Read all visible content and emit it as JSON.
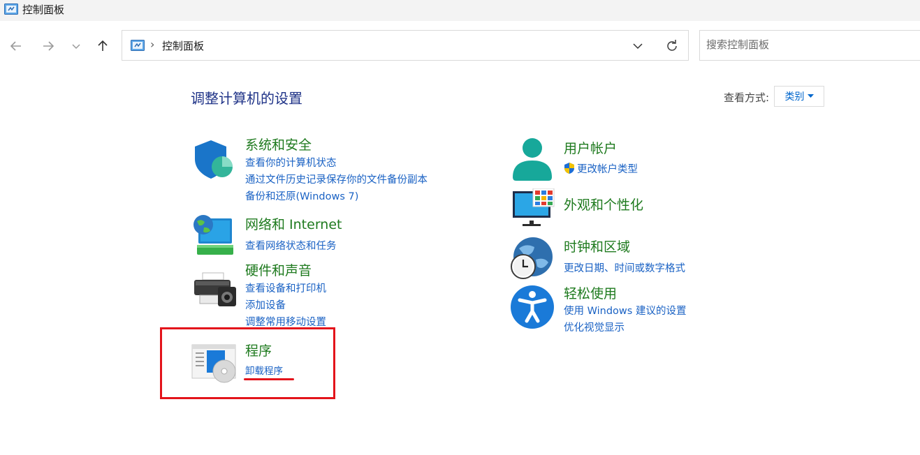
{
  "window": {
    "title": "控制面板"
  },
  "address": {
    "path_label": "控制面板",
    "separator": "›"
  },
  "search": {
    "placeholder": "搜索控制面板"
  },
  "page": {
    "heading": "调整计算机的设置",
    "view_by_label": "查看方式:",
    "view_by_value": "类别"
  },
  "categories": {
    "system_security": {
      "title": "系统和安全",
      "links": [
        "查看你的计算机状态",
        "通过文件历史记录保存你的文件备份副本",
        "备份和还原(Windows 7)"
      ]
    },
    "network": {
      "title": "网络和 Internet",
      "links": [
        "查看网络状态和任务"
      ]
    },
    "hardware": {
      "title": "硬件和声音",
      "links": [
        "查看设备和打印机",
        "添加设备",
        "调整常用移动设置"
      ]
    },
    "programs": {
      "title": "程序",
      "links": [
        "卸载程序"
      ]
    },
    "user_accounts": {
      "title": "用户帐户",
      "links": [
        "更改帐户类型"
      ]
    },
    "appearance": {
      "title": "外观和个性化",
      "links": []
    },
    "clock_region": {
      "title": "时钟和区域",
      "links": [
        "更改日期、时间或数字格式"
      ]
    },
    "ease_access": {
      "title": "轻松使用",
      "links": [
        "使用 Windows 建议的设置",
        "优化视觉显示"
      ]
    }
  },
  "icons": {
    "app": "control-panel-icon",
    "back": "arrow-left-icon",
    "forward": "arrow-right-icon",
    "recent": "chevron-down-icon",
    "up": "arrow-up-icon",
    "refresh": "refresh-icon",
    "uac": "uac-shield-icon"
  },
  "colors": {
    "category_title": "#1e7a1e",
    "link": "#1a62c4",
    "heading": "#1e3287",
    "annotation": "#e3141b"
  }
}
